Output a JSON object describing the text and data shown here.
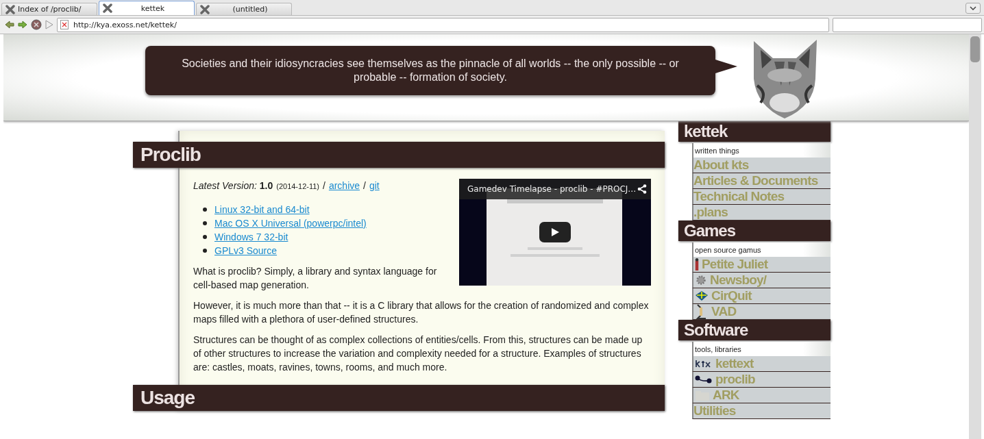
{
  "browser": {
    "tabs": [
      {
        "label": "Index of /proclib/",
        "selected": false
      },
      {
        "label": "kettek",
        "selected": true
      },
      {
        "label": "(untitled)",
        "selected": false
      }
    ],
    "address": "http://kya.exoss.net/kettek/"
  },
  "header": {
    "quote": "Societies and their idiosyncracies see themselves as the pinnacle of all worlds -- the only possible -- or probable -- formation of society."
  },
  "article": {
    "heading": "Proclib",
    "version": "*Latest Version:* **1.0**",
    "date": "(2014-12-11)",
    "links": [
      {
        "separator": "/",
        "label": "archive"
      },
      {
        "separator": "/",
        "label": "git"
      }
    ],
    "downloads": [
      "Linux 32-bit and 64-bit",
      "Mac OS X Universal (powerpc/intel)",
      "Windows 7 32-bit",
      "GPLv3 Source"
    ],
    "video": {
      "title": "Gamedev Timelapse - proclib - #PROCJ…"
    },
    "paragraphs": [
      "What is proclib? Simply, a library and syntax language for cell-based map generation.",
      "However, it is much more than that -- it is a C library that allows for the creation of randomized and complex maps filled with a plethora of user-defined structures.",
      "Structures can be thought of as complex collections of entities/cells. From this, structures can be made up of other structures to increase the variation and complexity needed for a structure. Examples of structures are: castles, moats, ravines, towns, rooms, and much more."
    ],
    "next_heading": "Usage"
  },
  "sidebar": [
    {
      "title": "kettek",
      "subtitle": "written things",
      "items": [
        {
          "label": "About kts",
          "kind": "plain"
        },
        {
          "label": "Articles & Documents",
          "kind": "plain"
        },
        {
          "label": "Technical Notes",
          "kind": "plain"
        },
        {
          "label": ".plans",
          "kind": "plain"
        }
      ]
    },
    {
      "title": "Games",
      "subtitle": "open source gamus",
      "items": [
        {
          "label": "Petite Juliet",
          "kind": "icon"
        },
        {
          "label": "Newsboy/",
          "kind": "icon"
        },
        {
          "label": "CirQuit",
          "kind": "icon"
        },
        {
          "label": "VAD",
          "kind": "icon"
        }
      ]
    },
    {
      "title": "Software",
      "subtitle": "tools, libraries",
      "items": [
        {
          "label": "kettext",
          "kind": "icon"
        },
        {
          "label": "proclib",
          "kind": "icon"
        },
        {
          "label": "ARK",
          "kind": "icon"
        },
        {
          "label": "Utilities",
          "kind": "plain"
        }
      ]
    }
  ]
}
